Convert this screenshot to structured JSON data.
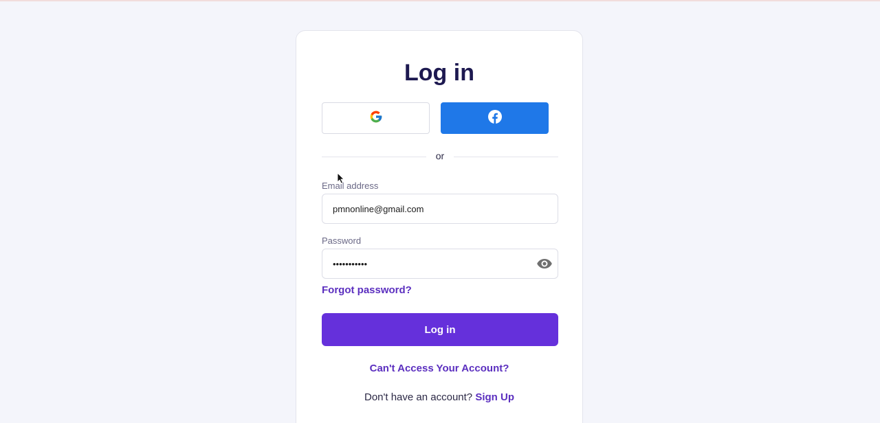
{
  "login": {
    "title": "Log in",
    "social": {
      "google_icon": "google-g-icon",
      "facebook_icon": "facebook-f-icon"
    },
    "divider_text": "or",
    "email": {
      "label": "Email address",
      "value": "pmnonline@gmail.com"
    },
    "password": {
      "label": "Password",
      "value": "•••••••••••",
      "toggle_icon": "eye-icon"
    },
    "forgot_password": "Forgot password?",
    "submit_label": "Log in",
    "cant_access": "Can't Access Your Account?",
    "signup_prompt": "Don't have an account?",
    "signup_link": "Sign Up"
  },
  "colors": {
    "background": "#f4f5fb",
    "title": "#1d1950",
    "accent": "#6530db",
    "link": "#5b2fbf",
    "facebook": "#1f78e8"
  }
}
